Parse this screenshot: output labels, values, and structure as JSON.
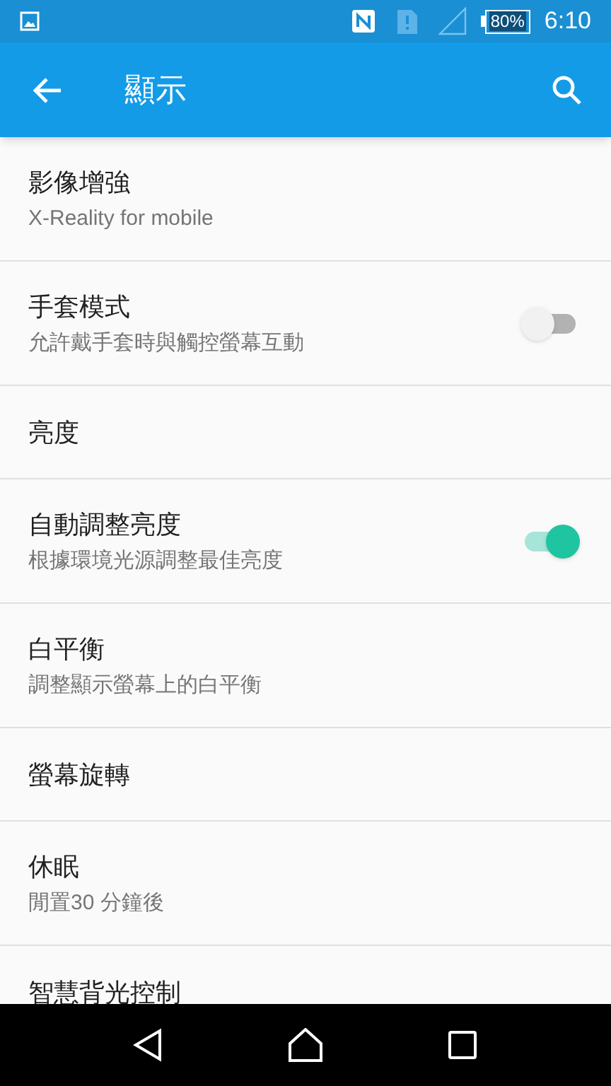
{
  "status_bar": {
    "battery": "80%",
    "time": "6:10"
  },
  "app_bar": {
    "title": "顯示"
  },
  "settings": [
    {
      "kind": "text",
      "title": "影像增強",
      "subtitle": "X-Reality for mobile"
    },
    {
      "kind": "toggle",
      "title": "手套模式",
      "subtitle": "允許戴手套時與觸控螢幕互動",
      "on": false
    },
    {
      "kind": "text",
      "title": "亮度"
    },
    {
      "kind": "toggle",
      "title": "自動調整亮度",
      "subtitle": "根據環境光源調整最佳亮度",
      "on": true
    },
    {
      "kind": "text",
      "title": "白平衡",
      "subtitle": "調整顯示螢幕上的白平衡"
    },
    {
      "kind": "text",
      "title": "螢幕旋轉"
    },
    {
      "kind": "text",
      "title": "休眠",
      "subtitle": "閒置30 分鐘後"
    },
    {
      "kind": "text",
      "title": "智慧背光控制"
    }
  ]
}
